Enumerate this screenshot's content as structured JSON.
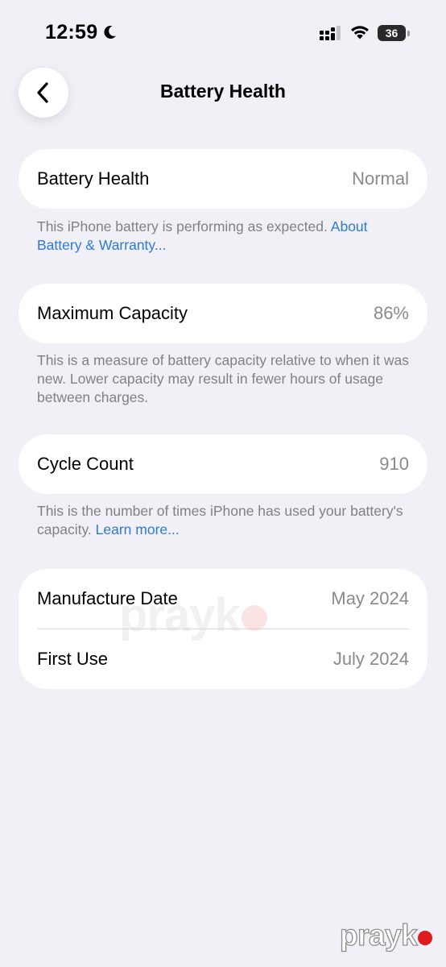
{
  "status_bar": {
    "time": "12:59",
    "battery_level": "36",
    "icons": [
      "moon-icon",
      "signal-icon",
      "wifi-icon",
      "battery-icon"
    ]
  },
  "nav": {
    "title": "Battery Health",
    "back_icon": "chevron-left-icon"
  },
  "sections": {
    "health": {
      "label": "Battery Health",
      "value": "Normal",
      "footnote": "This iPhone battery is performing as expected.",
      "footnote_link": "About Battery & Warranty..."
    },
    "capacity": {
      "label": "Maximum Capacity",
      "value": "86%",
      "footnote": "This is a measure of battery capacity relative to when it was new. Lower capacity may result in fewer hours of usage between charges."
    },
    "cycles": {
      "label": "Cycle Count",
      "value": "910",
      "footnote": "This is the number of times iPhone has used your battery's capacity.",
      "footnote_link": "Learn more..."
    },
    "dates": {
      "manufacture_label": "Manufacture Date",
      "manufacture_value": "May 2024",
      "first_use_label": "First Use",
      "first_use_value": "July 2024"
    }
  },
  "watermark": {
    "center_text": "prayk",
    "corner_text": "prayk"
  },
  "colors": {
    "background": "#f1f0f6",
    "card": "#ffffff",
    "secondary_text": "#8a8a8e",
    "link": "#2b7bd6",
    "watermark_dot": "#e01b1b"
  }
}
